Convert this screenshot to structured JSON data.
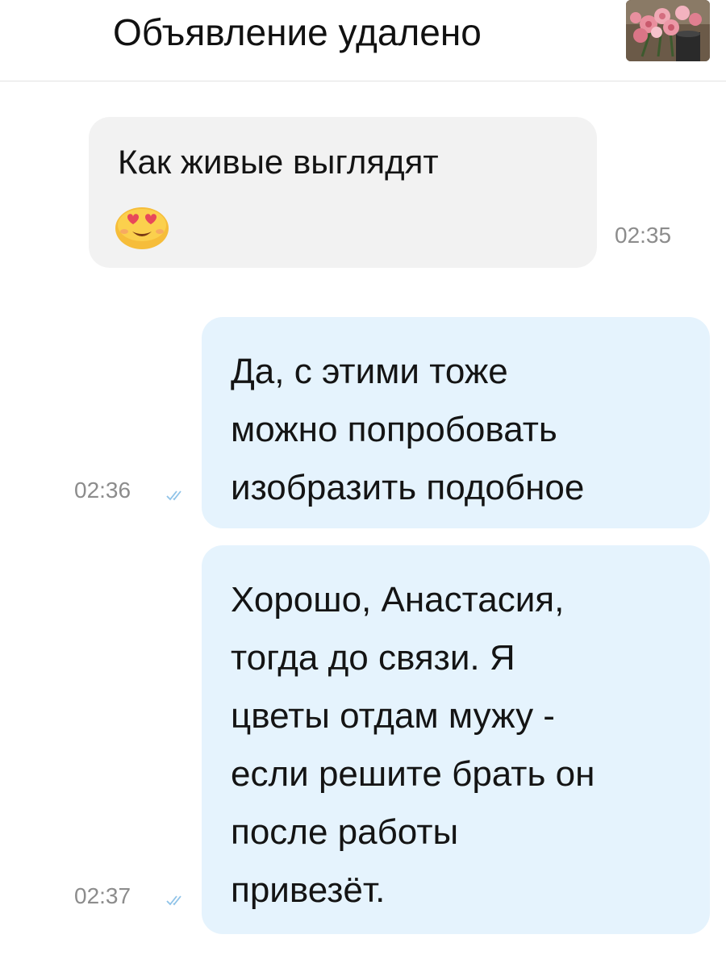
{
  "header": {
    "title": "Объявление удалено"
  },
  "messages": [
    {
      "direction": "incoming",
      "text": "Как живые выглядят",
      "emoji": "smiling-face-with-heart-eyes",
      "time": "02:35"
    },
    {
      "direction": "outgoing",
      "text": "Да, с этими тоже\nможно попробовать\nизобразить подобное",
      "time": "02:36",
      "status": "read"
    },
    {
      "direction": "outgoing",
      "text": "Хорошо, Анастасия,\nтогда до связи. Я\nцветы отдам мужу -\nесли решите брать он\nпосле работы\nпривезёт.",
      "time": "02:37",
      "status": "read"
    }
  ],
  "colors": {
    "incoming_bubble": "#f2f2f2",
    "outgoing_bubble": "#e5f3fd",
    "timestamp": "#8c8c8c",
    "read_check": "#8fc3e8"
  }
}
